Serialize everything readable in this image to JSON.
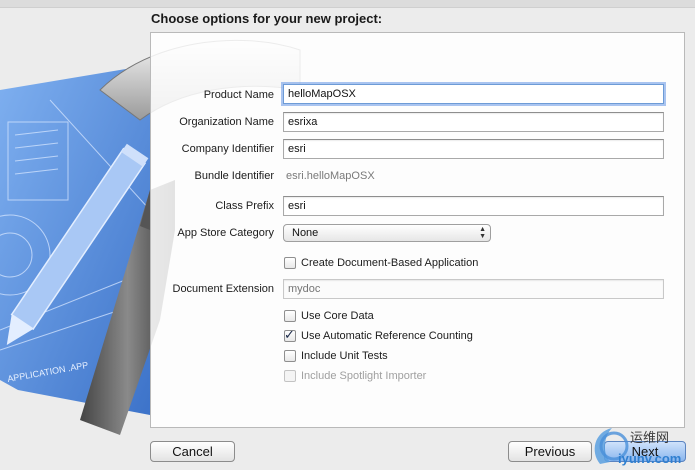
{
  "dialog": {
    "title": "Choose options for your new project:"
  },
  "fields": {
    "product_name": {
      "label": "Product Name",
      "value": "helloMapOSX"
    },
    "organization_name": {
      "label": "Organization Name",
      "value": "esrixa"
    },
    "company_identifier": {
      "label": "Company Identifier",
      "value": "esri"
    },
    "bundle_identifier": {
      "label": "Bundle Identifier",
      "value": "esri.helloMapOSX"
    },
    "class_prefix": {
      "label": "Class Prefix",
      "value": "esri"
    },
    "app_store_category": {
      "label": "App Store Category",
      "value": "None"
    },
    "document_extension": {
      "label": "Document Extension",
      "placeholder": "mydoc"
    }
  },
  "options": {
    "create_document_based": {
      "label": "Create Document-Based Application",
      "checked": false
    },
    "use_core_data": {
      "label": "Use Core Data",
      "checked": false
    },
    "use_arc": {
      "label": "Use Automatic Reference Counting",
      "checked": true
    },
    "include_unit_tests": {
      "label": "Include Unit Tests",
      "checked": false
    },
    "include_spotlight": {
      "label": "Include Spotlight Importer",
      "checked": false,
      "disabled": true
    }
  },
  "buttons": {
    "cancel": "Cancel",
    "previous": "Previous",
    "next": "Next"
  },
  "artwork": {
    "blueprint_text": "APPLICATION .APP"
  },
  "watermark": {
    "text_cn": "运维网",
    "text_url": "iyunv.com"
  },
  "colors": {
    "focus_ring": "#6d9bd6",
    "blueprint": "#4f86d8",
    "primary_button": "#8ab6ee"
  },
  "icons": {
    "checkmark": "checkmark-icon",
    "select_arrows": "updown-arrows-icon",
    "xcode_artwork": "xcode-hammer-blueprint-icon"
  }
}
